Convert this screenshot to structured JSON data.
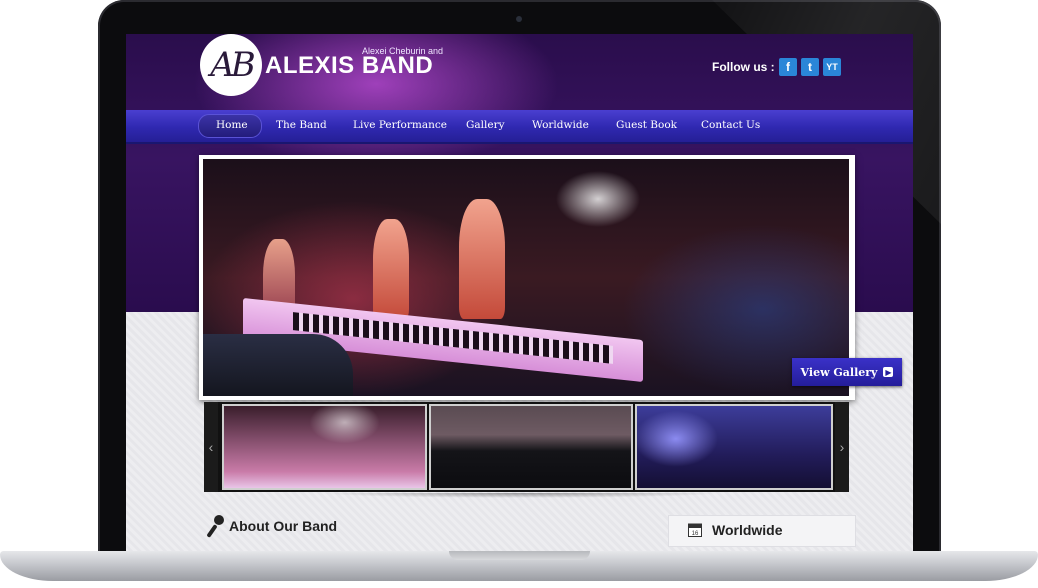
{
  "brand": {
    "logo_text": "AB",
    "tagline": "Alexei Cheburin and",
    "name": "ALEXIS BAND"
  },
  "follow": {
    "label": "Follow us :",
    "icons": [
      {
        "name": "facebook-icon",
        "glyph": "f"
      },
      {
        "name": "twitter-icon",
        "glyph": "t"
      },
      {
        "name": "youtube-icon",
        "glyph": "YT"
      }
    ]
  },
  "nav": {
    "items": [
      "Home",
      "The Band",
      "Live Performance",
      "Gallery",
      "Worldwide",
      "Guest Book",
      "Contact Us"
    ],
    "active": "Home"
  },
  "slider": {
    "button_label": "View Gallery",
    "prev_arrow": "‹",
    "next_arrow": "›"
  },
  "sections": {
    "about_title": "About Our Band",
    "worldwide_title": "Worldwide"
  },
  "colors": {
    "header_bg": "#2a0d4c",
    "nav_bg": "#2f28b0",
    "accent": "#2a86d8"
  }
}
